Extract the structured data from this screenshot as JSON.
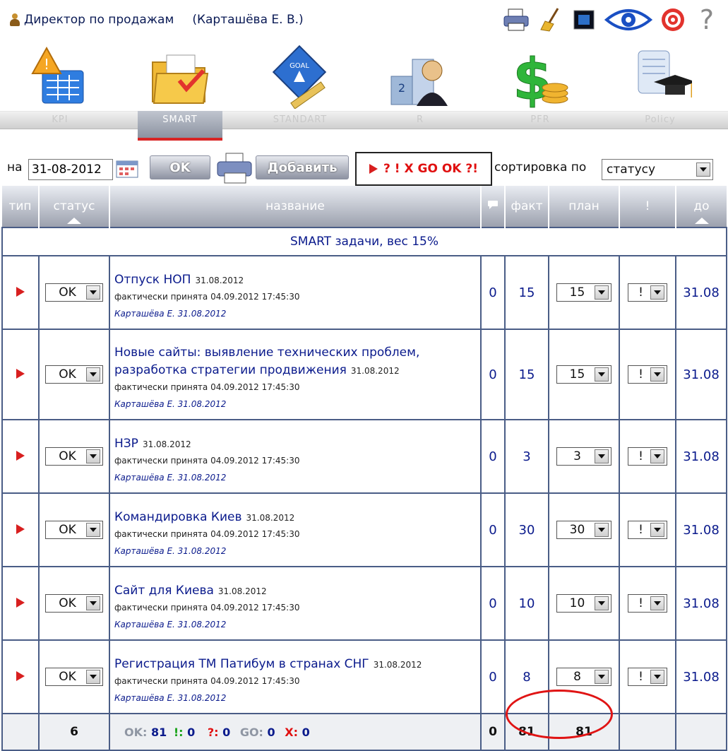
{
  "header": {
    "user_title": "Директор по продажам",
    "user_name": "(Карташёва Е. В.)",
    "tools": [
      "printer-icon",
      "broom-icon",
      "fullscreen-icon",
      "eye-icon",
      "target-icon",
      "help-icon"
    ]
  },
  "modules": [
    {
      "label": "KPI",
      "icon": "kpi-icon"
    },
    {
      "label": "SMART",
      "icon": "smart-folder-icon"
    },
    {
      "label": "STANDART",
      "icon": "goal-icon"
    },
    {
      "label": "R",
      "icon": "ranking-icon"
    },
    {
      "label": "PFR",
      "icon": "money-icon"
    },
    {
      "label": "Policy",
      "icon": "policy-icon"
    }
  ],
  "toolbar": {
    "date_prefix": "на",
    "date_value": "31-08-2012",
    "ok_label": "OK",
    "add_label": "Добавить",
    "filter_label": "? ! X GO OK ?!",
    "sort_label": "сортировка по",
    "sort_value": "статусу"
  },
  "table": {
    "headers": [
      "тип",
      "статус",
      "название",
      "факт",
      "план",
      "!",
      "до"
    ],
    "section_title": "SMART задачи, вес 15%",
    "rows": [
      {
        "title": "Отпуск НОП",
        "date": "31.08.2012",
        "accepted": "фактически принята 04.09.2012 17:45:30",
        "author": "Карташёва Е. 31.08.2012",
        "status": "OK",
        "comments": "0",
        "fact": "15",
        "plan": "15",
        "flag": "!",
        "due": "31.08"
      },
      {
        "title": "Новые сайты: выявление технических проблем, разработка стратегии продвижения",
        "date": "31.08.2012",
        "accepted": "фактически принята 04.09.2012 17:45:30",
        "author": "Карташёва Е. 31.08.2012",
        "status": "OK",
        "comments": "0",
        "fact": "15",
        "plan": "15",
        "flag": "!",
        "due": "31.08"
      },
      {
        "title": "НЗР",
        "date": "31.08.2012",
        "accepted": "фактически принята 04.09.2012 17:45:30",
        "author": "Карташёва Е. 31.08.2012",
        "status": "OK",
        "comments": "0",
        "fact": "3",
        "plan": "3",
        "flag": "!",
        "due": "31.08"
      },
      {
        "title": "Командировка Киев",
        "date": "31.08.2012",
        "accepted": "фактически принята 04.09.2012 17:45:30",
        "author": "Карташёва Е. 31.08.2012",
        "status": "OK",
        "comments": "0",
        "fact": "30",
        "plan": "30",
        "flag": "!",
        "due": "31.08"
      },
      {
        "title": "Сайт для Киева",
        "date": "31.08.2012",
        "accepted": "фактически принята 04.09.2012 17:45:30",
        "author": "Карташёва Е. 31.08.2012",
        "status": "OK",
        "comments": "0",
        "fact": "10",
        "plan": "10",
        "flag": "!",
        "due": "31.08"
      },
      {
        "title": "Регистрация ТМ Патибум в странах СНГ",
        "date": "31.08.2012",
        "accepted": "фактически принята 04.09.2012 17:45:30",
        "author": "Карташёва Е. 31.08.2012",
        "status": "OK",
        "comments": "0",
        "fact": "8",
        "plan": "8",
        "flag": "!",
        "due": "31.08"
      }
    ],
    "footer": {
      "count": "6",
      "ok_label": "OK:",
      "ok_value": "81",
      "excl_label": "!:",
      "excl_value": "0",
      "q_label": "?:",
      "q_value": "0",
      "go_label": "GO:",
      "go_value": "0",
      "x_label": "X:",
      "x_value": "0",
      "comments_total": "0",
      "fact_total": "81",
      "plan_total": "81"
    }
  },
  "colors": {
    "accent_blue": "#0a1a8c",
    "alert_red": "#e01010",
    "header_grey": "#9ca1ae"
  }
}
